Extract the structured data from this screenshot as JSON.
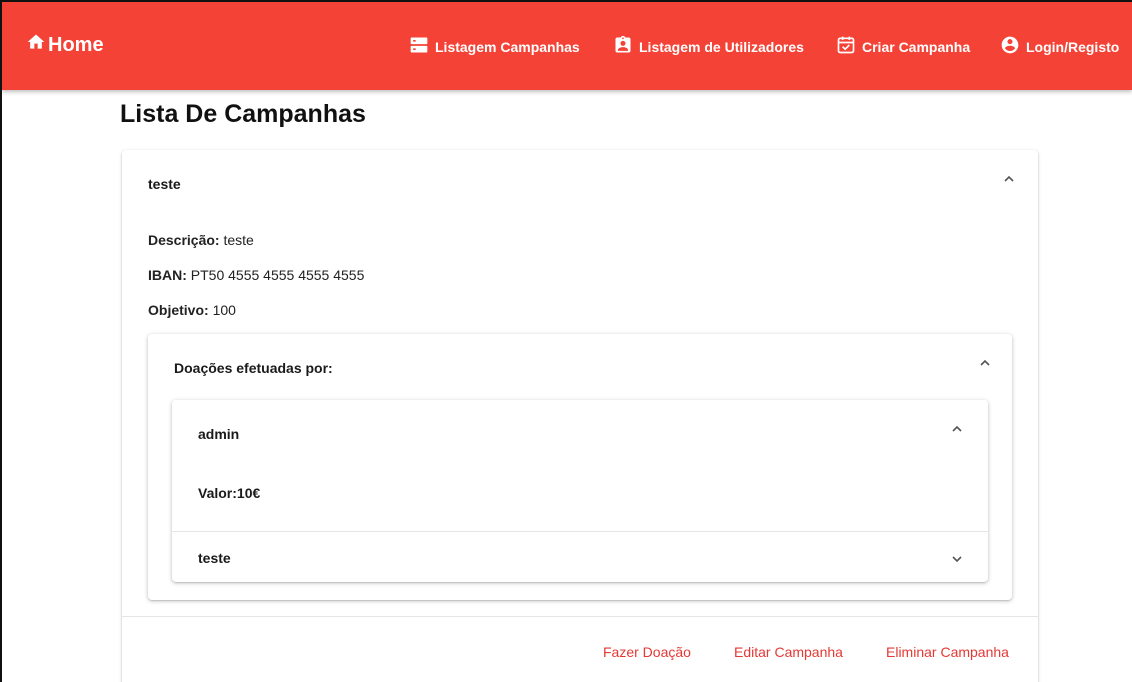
{
  "navbar": {
    "home_label": "Home",
    "items": [
      {
        "label": "Listagem Campanhas",
        "icon": "list-icon"
      },
      {
        "label": "Listagem de Utilizadores",
        "icon": "clipboard-user-icon"
      },
      {
        "label": "Criar Campanha",
        "icon": "calendar-check-icon"
      },
      {
        "label": "Login/Registo",
        "icon": "account-circle-icon"
      }
    ],
    "color": "#f44336"
  },
  "page": {
    "title": "Lista De Campanhas"
  },
  "campaign": {
    "name": "teste",
    "description_label": "Descrição:",
    "description": "teste",
    "iban_label": "IBAN:",
    "iban": "PT50 4555 4555 4555 4555",
    "goal_label": "Objetivo:",
    "goal": "100",
    "donations": {
      "title": "Doações efetuadas por:",
      "donors": [
        {
          "name": "admin",
          "expanded": true,
          "value_label": "Valor:10€"
        },
        {
          "name": "teste",
          "expanded": false
        }
      ]
    },
    "actions": {
      "donate": "Fazer Doação",
      "edit": "Editar Campanha",
      "delete": "Eliminar Campanha"
    },
    "action_color": "#e53935"
  }
}
